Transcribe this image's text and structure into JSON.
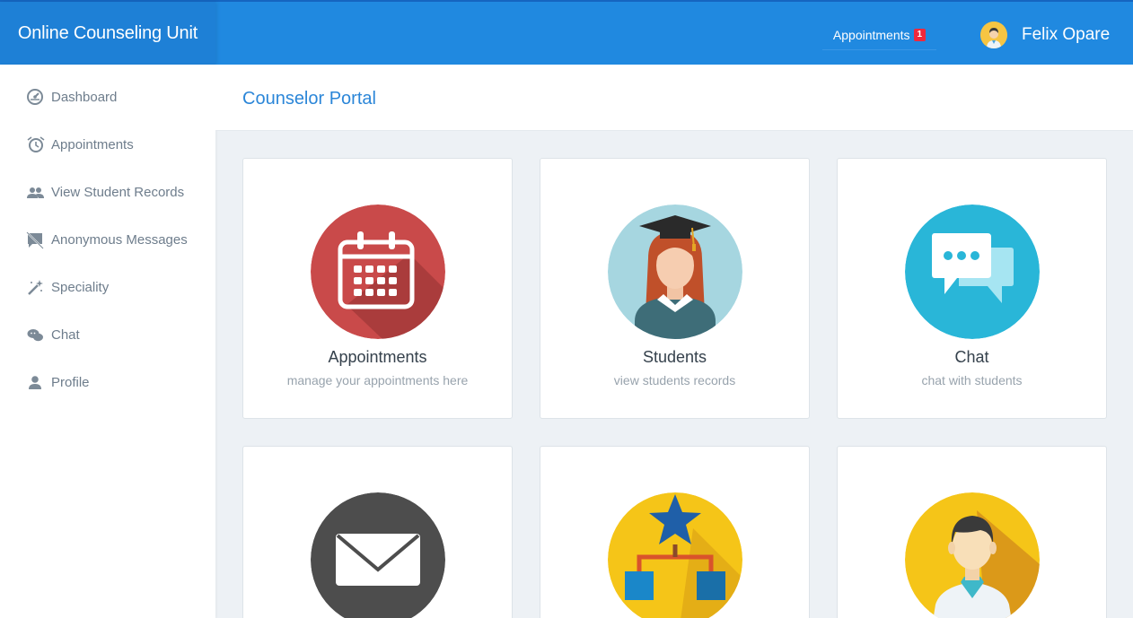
{
  "brand": "Online Counseling Unit",
  "topnav": {
    "appointments_label": "Appointments",
    "appointments_badge": "1",
    "user_name": "Felix Opare"
  },
  "sidebar": {
    "items": [
      {
        "label": "Dashboard",
        "icon": "dashboard-icon"
      },
      {
        "label": "Appointments",
        "icon": "alarm-clock-icon"
      },
      {
        "label": "View Student Records",
        "icon": "people-icon"
      },
      {
        "label": "Anonymous Messages",
        "icon": "message-off-icon"
      },
      {
        "label": "Speciality",
        "icon": "magic-wand-icon"
      },
      {
        "label": "Chat",
        "icon": "chat-bubbles-icon"
      },
      {
        "label": "Profile",
        "icon": "person-icon"
      }
    ]
  },
  "page": {
    "title": "Counselor Portal"
  },
  "cards": [
    {
      "title": "Appointments",
      "subtitle": "manage your appointments here",
      "icon": "calendar-icon",
      "color": "#c94a4a"
    },
    {
      "title": "Students",
      "subtitle": "view students records",
      "icon": "graduate-icon",
      "color": "#a6d6e0"
    },
    {
      "title": "Chat",
      "subtitle": "chat with students",
      "icon": "chat-icon",
      "color": "#29b6d8"
    },
    {
      "title": "",
      "subtitle": "",
      "icon": "envelope-icon",
      "color": "#4d4d4d"
    },
    {
      "title": "",
      "subtitle": "",
      "icon": "hierarchy-star-icon",
      "color": "#f5c518"
    },
    {
      "title": "",
      "subtitle": "",
      "icon": "doctor-icon",
      "color": "#f5c518"
    }
  ],
  "colors": {
    "topbar": "#2089e0",
    "brand_bg": "#1e80d6",
    "accent_text": "#2b86d8",
    "badge": "#f0283c",
    "sidebar_text": "#6e7d8c",
    "content_bg": "#edf1f5"
  }
}
